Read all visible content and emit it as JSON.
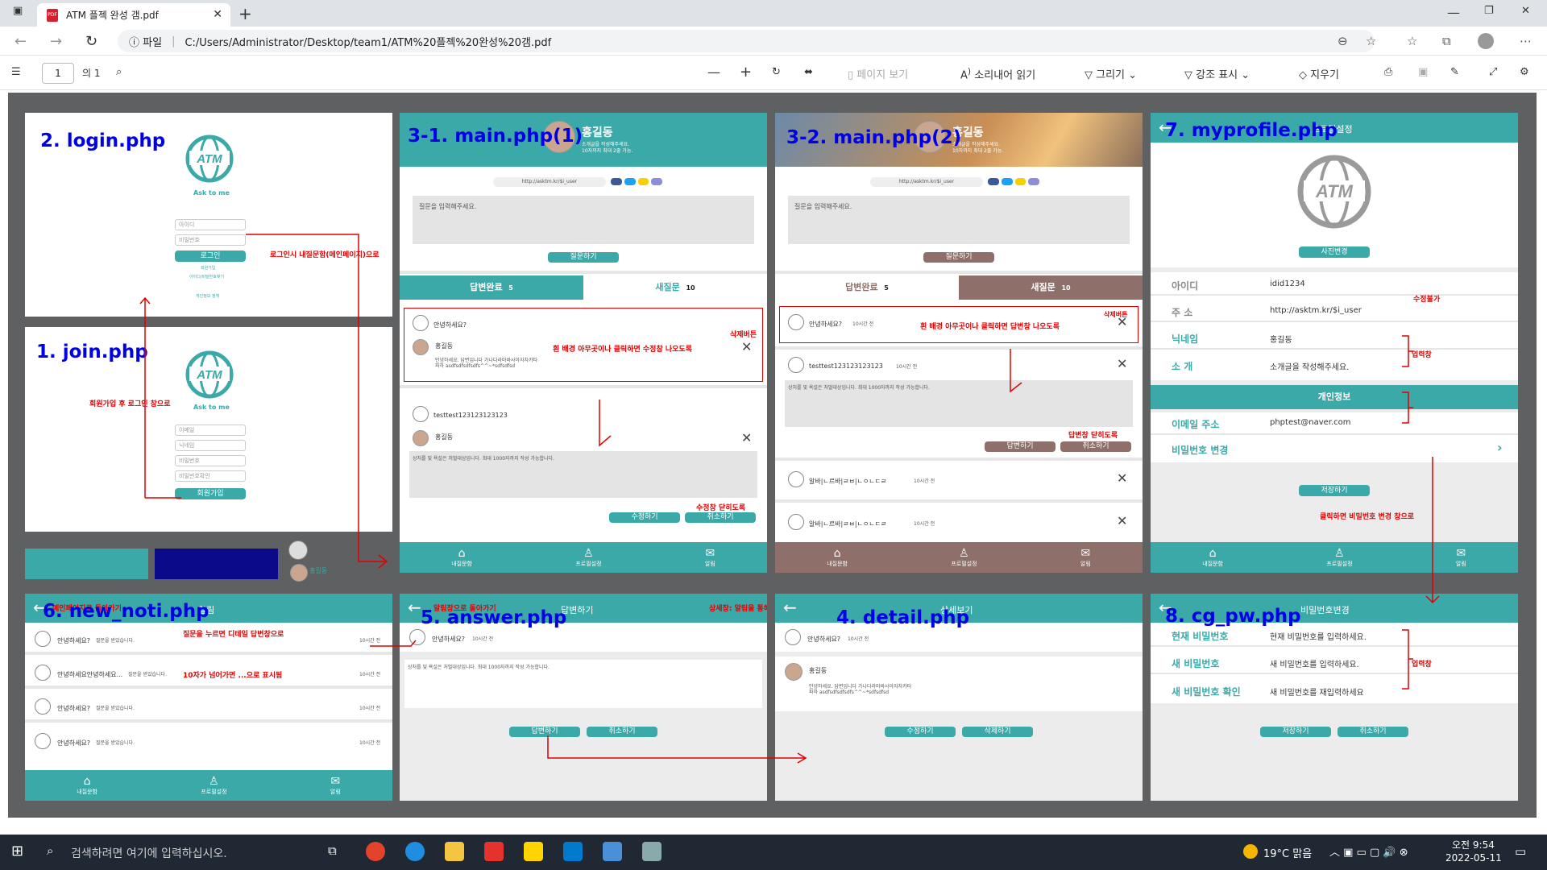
{
  "browser": {
    "tab_title": "ATM 플젝 완성 갬.pdf",
    "url_scheme": "파일",
    "url": "C:/Users/Administrator/Desktop/team1/ATM%20플젝%20완성%20갬.pdf"
  },
  "pdf_toolbar": {
    "page": "1",
    "of": "의 1",
    "page_view": "페이지 보기",
    "read_aloud": "소리내어 읽기",
    "draw": "그리기",
    "highlight": "강조 표시",
    "erase": "지우기"
  },
  "labels": {
    "login": "2. login.php",
    "join": "1. join.php",
    "main1": "3-1. main.php(1)",
    "main2": "3-2. main.php(2)",
    "myprofile": "7. myprofile.php",
    "noti": "6. new_noti.php",
    "answer": "5. answer.php",
    "detail": "4. detail.php",
    "cgpw": "8. cg_pw.php"
  },
  "login": {
    "logo": "ATM",
    "tagline": "Ask to me",
    "id": "아이디",
    "pw": "비밀번호",
    "btn": "로그인",
    "link1": "회원가입",
    "link2": "아이디/비밀번호찾기",
    "link3": "개인정보 정책"
  },
  "join": {
    "f1": "이메일",
    "f2": "닉네임",
    "f3": "비밀번호",
    "f4": "비밀번호확인",
    "btn": "회원가입"
  },
  "main": {
    "name": "홍길동",
    "intro": "소개글을 작성해주세요.",
    "intro2": "10자까지 최대 2줄 가능.",
    "link": "http://asktm.kr/$i_user",
    "question_ph": "질문을 입력해주세요.",
    "ask_btn": "질문하기",
    "tab_done": "답변완료",
    "done_n": "5",
    "tab_new": "새질문",
    "new_n": "10",
    "q1": "안녕하세요?",
    "ans_name": "홍길동",
    "ans_text": "안녕하세요. 답변입니다 가나다라마바사아자차카타파하 asdfsdfsdfsdfs^^~*sdfsdfsd",
    "q2": "testtest123123123123",
    "reply_ph": "상처를 및 욕설은 처벌대상입니다. 최대 1000자까지 작성 가능합니다.",
    "edit_btn": "수정하기",
    "cancel_btn": "취소하기",
    "ago": "10시간 전",
    "q3": "알바|ㄴ르바|ㄹㅂ|ㄴㅇㄴㄷㄹ",
    "answer_btn": "답변하기",
    "nav1": "내질문함",
    "nav2": "프로필설정",
    "nav3": "알림"
  },
  "notes": {
    "login_to_main": "로그인시 내질문함(메인페이지)으로",
    "join_to_login": "회원가입 후 로그인 창으로",
    "delete_btn": "삭제버튼",
    "edit_hint": "흰 배경 아무곳이나 클릭하면 수정창 나오도록",
    "edit_close": "수정창 닫히도록",
    "reply_hint": "흰 배경 아무곳이나 클릭하면 답변창 나오도록",
    "reply_close": "답변창 닫히도록",
    "readonly": "수정불가",
    "input": "입력창",
    "to_cgpw": "클릭하면 비밀번호 변경 창으로",
    "back_main": "메인페이지로 돌아가기",
    "to_detail": "질문을 누르면 디테일 답변창으로",
    "ten_chars": "10자가 넘어가면 ...으로 표시됨",
    "back_noti": "알림창으로 돌아가기",
    "detail_note": "상세창: 알림을 통해 들어가면 노출됨",
    "input2": "입력창"
  },
  "profile": {
    "title": "프로필설정",
    "photo_btn": "사진변경",
    "id_l": "아이디",
    "id_v": "idid1234",
    "addr_l": "주 소",
    "addr_v": "http://asktm.kr/$i_user",
    "nick_l": "닉네임",
    "nick_v": "홍길동",
    "intro_l": "소 개",
    "intro_v": "소개글을 작성해주세요.",
    "personal": "개인정보",
    "email_l": "이메일 주소",
    "email_v": "phptest@naver.com",
    "pw_l": "비밀번호 변경",
    "save": "저장하기"
  },
  "noti": {
    "title": "알림",
    "row1": "안녕하세요?",
    "row1b": "질문을 받았습니다.",
    "row2": "안녕하세요안녕하세요...",
    "row2b": "질문을 받았습니다.",
    "ago": "10시간 전"
  },
  "answer": {
    "title": "답변하기",
    "q": "안녕하세요?",
    "btn": "답변하기",
    "cancel": "취소하기"
  },
  "detail": {
    "title": "상세보기",
    "edit": "수정하기",
    "del": "삭제하기"
  },
  "cgpw": {
    "title": "비밀번호변경",
    "cur_l": "현재 비밀번호",
    "cur_v": "현재 비밀번호를 입력하세요.",
    "new_l": "새 비밀번호",
    "new_v": "새 비밀번호를 입력하세요.",
    "conf_l": "새 비밀번호 확인",
    "conf_v": "새 비밀번호를 재입력하세요",
    "save": "저장하기",
    "cancel": "취소하기"
  },
  "taskbar": {
    "search": "검색하려면 여기에 입력하십시오.",
    "weather": "19°C 맑음",
    "time": "오전 9:54",
    "date": "2022-05-11"
  },
  "colors": {
    "teal": "#3aa9a8",
    "brown": "#8f6f69",
    "navy": "#0a0a8a",
    "annotation": "#e00000",
    "label": "#0000e6"
  }
}
